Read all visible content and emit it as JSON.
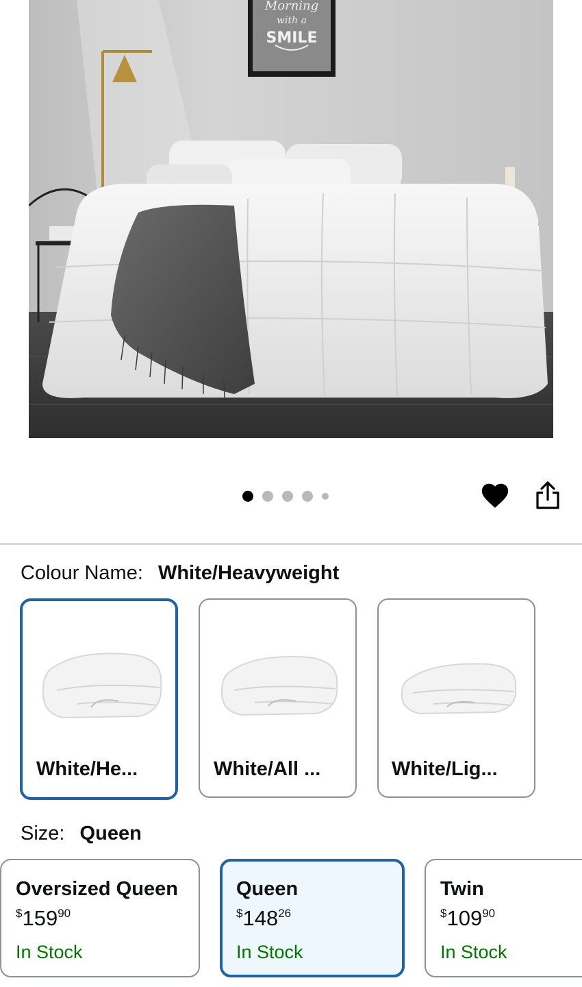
{
  "product_image": {
    "poster_text": [
      "Morning",
      "with a",
      "SMILE"
    ],
    "carousel": {
      "count": 5,
      "active_index": 0
    }
  },
  "actions": {
    "wishlist_icon": "heart-icon",
    "share_icon": "share-icon"
  },
  "colour": {
    "label": "Colour Name:",
    "selected": "White/Heavyweight",
    "options": [
      {
        "label": "White/He...",
        "selected": true
      },
      {
        "label": "White/All ...",
        "selected": false
      },
      {
        "label": "White/Lig...",
        "selected": false
      }
    ]
  },
  "size": {
    "label": "Size:",
    "selected": "Queen",
    "options": [
      {
        "name": "Oversized Queen",
        "currency": "$",
        "price_whole": "159",
        "price_fraction": "90",
        "availability": "In Stock",
        "selected": false
      },
      {
        "name": "Queen",
        "currency": "$",
        "price_whole": "148",
        "price_fraction": "26",
        "availability": "In Stock",
        "selected": true
      },
      {
        "name": "Twin",
        "currency": "$",
        "price_whole": "109",
        "price_fraction": "90",
        "availability": "In Stock",
        "selected": false
      }
    ]
  },
  "colors": {
    "selected_border": "#2162a1",
    "selected_bg": "#edf7fd",
    "in_stock": "#007600",
    "border": "#8d9096"
  }
}
